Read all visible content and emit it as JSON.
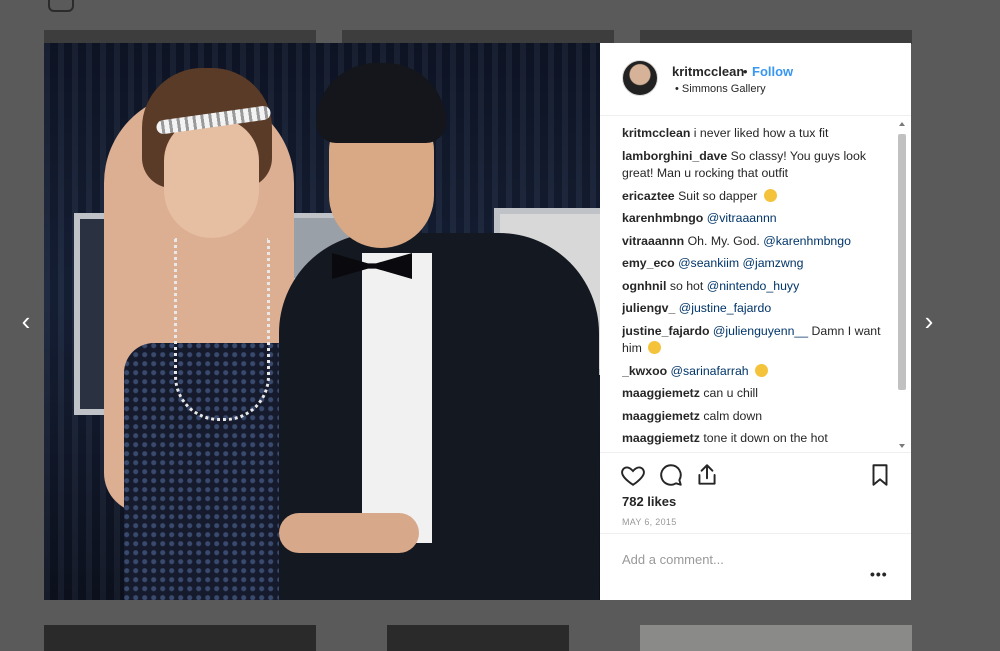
{
  "nav": {
    "prev_label": "‹",
    "next_label": "›"
  },
  "post": {
    "username": "kritmcclean",
    "separator": "•",
    "follow_label": "Follow",
    "location": "• Simmons Gallery",
    "likes": "782 likes",
    "date": "MAY 6, 2015",
    "add_comment_placeholder": "Add a comment...",
    "more_label": "•••"
  },
  "comments": [
    {
      "user": "kritmcclean",
      "text": "i never liked how a tux fit"
    },
    {
      "user": "lamborghini_dave",
      "text": "So classy! You guys look great! Man u rocking that outfit"
    },
    {
      "user": "ericaztee",
      "text": "Suit so dapper",
      "emoji": "ok-hand"
    },
    {
      "user": "karenhmbngo",
      "mention": "@vitraaannn"
    },
    {
      "user": "vitraaannn",
      "text": "Oh. My. God.",
      "mention": "@karenhmbngo"
    },
    {
      "user": "emy_eco",
      "mention": "@seankiim @jamzwng"
    },
    {
      "user": "ognhnil",
      "text": "so hot",
      "mention": "@nintendo_huyy"
    },
    {
      "user": "juliengv_",
      "mention": "@justine_fajardo"
    },
    {
      "user": "justine_fajardo",
      "mention": "@julienguyenn__",
      "text": "Damn I want him",
      "emoji": "laughing"
    },
    {
      "user": "_kwxoo",
      "mention": "@sarinafarrah",
      "emoji": "crying"
    },
    {
      "user": "maaggiemetz",
      "text": "can u chill"
    },
    {
      "user": "maaggiemetz",
      "text": "calm down"
    },
    {
      "user": "maaggiemetz",
      "text": "tone it down on the hot"
    }
  ],
  "icons": {
    "like": "heart-icon",
    "comment": "comment-bubble-icon",
    "share": "share-icon",
    "save": "bookmark-icon"
  },
  "colors": {
    "follow": "#3897f0",
    "mention": "#003569",
    "overlay": "#5a5a5a"
  }
}
